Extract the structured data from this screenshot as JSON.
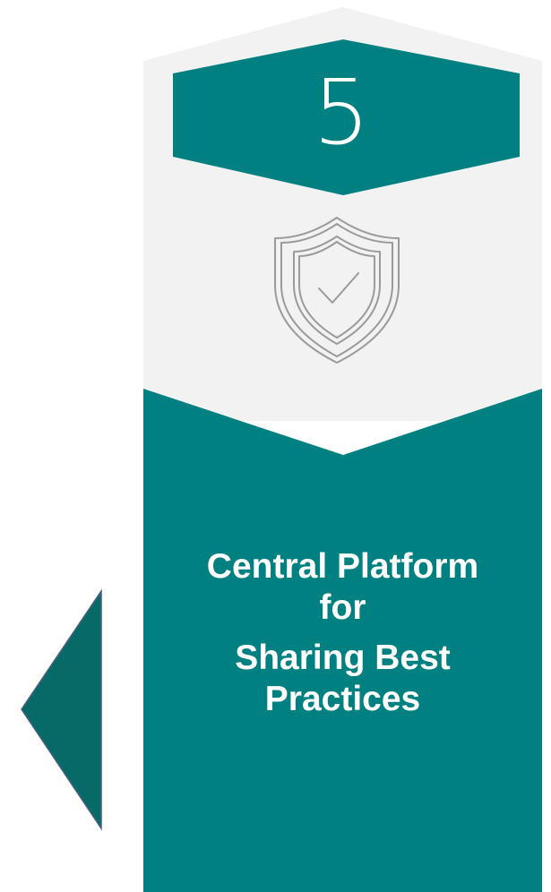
{
  "step": {
    "number": "5",
    "icon": "shield-check-icon",
    "title_lines": [
      "Central Platform",
      "for",
      "Sharing Best",
      "Practices"
    ]
  },
  "colors": {
    "teal": "#008080",
    "teal_dark": "#066b67",
    "panel_gray": "#f2f2f2",
    "icon_gray": "#9a9a9a",
    "text_white": "#ffffff",
    "arrow_border": "#4a5e8a"
  },
  "arrow": {
    "direction": "left"
  }
}
